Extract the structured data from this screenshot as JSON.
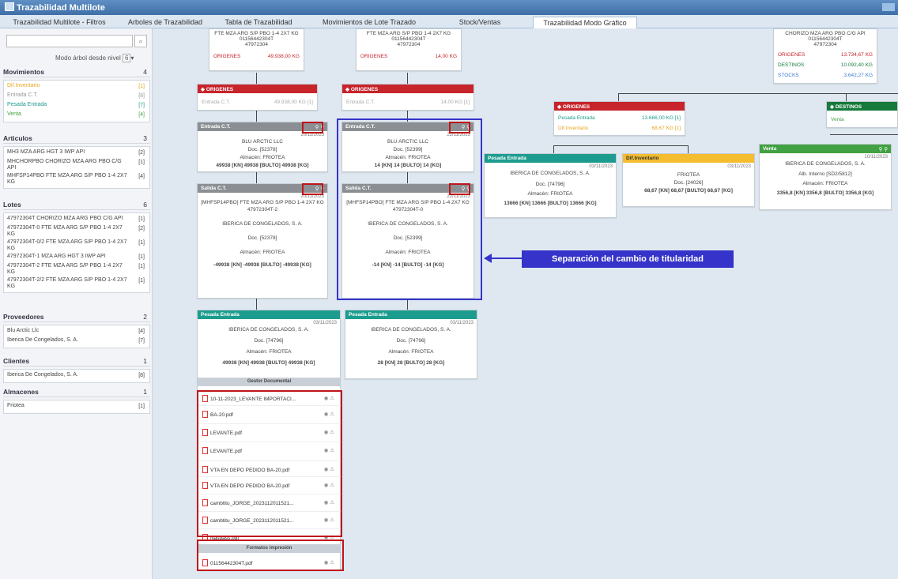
{
  "window": {
    "title": "Trazabilidad Multilote"
  },
  "tabs": [
    "Trazabilidad Multilote - Filtros",
    "Arboles de Trazabilidad",
    "Tabla de Trazabilidad",
    "Movimientos de Lote Trazado",
    "Stock/Ventas",
    "Trazabilidad Modo Gráfico"
  ],
  "sidebar": {
    "modo_label": "Modo árbol desde nivel",
    "modo_value": "6",
    "movimientos": {
      "title": "Movimientos",
      "count": "4",
      "items": [
        {
          "label": "Dif.Inventario",
          "count": "[1]"
        },
        {
          "label": "Entrada C.T.",
          "count": "[8]"
        },
        {
          "label": "Pesada Entrada",
          "count": "[7]"
        },
        {
          "label": "Venta",
          "count": "[4]"
        }
      ]
    },
    "articulos": {
      "title": "Articulos",
      "count": "3",
      "items": [
        {
          "label": "MH3 MZA ARG HGT 3 IWP API",
          "count": "[2]"
        },
        {
          "label": "MHCHORPBO CHORIZO MZA ARG PBO C/G API",
          "count": "[1]"
        },
        {
          "label": "MHFSP14PBO FTE MZA ARG S/P PBO 1-4 2X7 KG",
          "count": "[4]"
        }
      ]
    },
    "lotes": {
      "title": "Lotes",
      "count": "6",
      "items": [
        {
          "label": "47972304T CHORIZO MZA ARG PBO C/G API",
          "count": "[1]"
        },
        {
          "label": "47972304T-0 FTE MZA ARG S/P PBO 1-4 2X7 KG",
          "count": "[2]"
        },
        {
          "label": "47972304T-0/2 FTE MZA ARG S/P PBO 1-4 2X7 KG",
          "count": "[1]"
        },
        {
          "label": "47972304T-1 MZA ARG HGT 3 IWP API",
          "count": "[1]"
        },
        {
          "label": "47972304T-2 FTE MZA ARG S/P PBO 1-4 2X7 KG",
          "count": "[1]"
        },
        {
          "label": "47972304T-2/2 FTE MZA ARG S/P PBO 1-4 2X7 KG",
          "count": "[1]"
        }
      ]
    },
    "proveedores": {
      "title": "Proveedores",
      "count": "2",
      "items": [
        {
          "label": "Blu Arctic Llc",
          "count": "[4]"
        },
        {
          "label": "Iberica De Congelados, S. A.",
          "count": "[7]"
        }
      ]
    },
    "clientes": {
      "title": "Clientes",
      "count": "1",
      "items": [
        {
          "label": "Iberica De Congelados, S. A.",
          "count": "[8]"
        }
      ]
    },
    "almacenes": {
      "title": "Almacenes",
      "count": "1",
      "items": [
        {
          "label": "Friotea",
          "count": "[1]"
        }
      ]
    }
  },
  "graph": {
    "top_l": {
      "l1": "FTE MZA ARG S/P PBO 1-4 2X7 KG",
      "l2": "01156442304T",
      "l3": "47972304",
      "or": "ORIGENES",
      "orv": "49.938,00 KG"
    },
    "top_m": {
      "l1": "FTE MZA ARG S/P PBO 1-4 2X7 KG",
      "l2": "01156442304T",
      "l3": "47972304",
      "or": "ORIGENES",
      "orv": "14,00 KG"
    },
    "top_r": {
      "l1": "CHORIZO MZA ARG PBO C/G API",
      "l2": "01156442304T",
      "l3": "47972304",
      "or": "ORIGENES",
      "orv": "13.734,67 KG",
      "de": "DESTINOS",
      "dev": "10.092,40 KG",
      "st": "STOCKS",
      "stv": "3.642,27 KG"
    },
    "org_l": {
      "h": "ORIGENES",
      "i": "Entrada C.T.",
      "v": "49.938,00 KG [1]"
    },
    "org_m": {
      "h": "ORIGENES",
      "i": "Entrada C.T.",
      "v": "14,00 KG [1]"
    },
    "org_r": {
      "h": "ORIGENES",
      "i1": "Pesada Entrada",
      "v1": "13.666,00 KG [1]",
      "i2": "Dif.Inventario",
      "v2": "68,67 KG [1]"
    },
    "dest_r": {
      "h": "DESTINOS",
      "i": "Venta"
    },
    "ent_l": {
      "h": "Entrada C.T.",
      "d": "20/11/2023",
      "a": "BLU ARCTIC LLC",
      "b": "Doc. [52378]",
      "c": "Almacén: FRIOTEA",
      "e": "49938 [KN] 49938 [BULTO] 49938 [KG]"
    },
    "ent_m": {
      "h": "Entrada C.T.",
      "d": "22/11/2023",
      "a": "BLU ARCTIC LLC",
      "b": "Doc. [52399]",
      "c": "Almacén: FRIOTEA",
      "e": "14 [KN] 14 [BULTO] 14 [KG]"
    },
    "sal_l": {
      "h": "Salida C.T.",
      "d": "20/11/2023",
      "a": "[MHFSP14PBO] FTE MZA ARG S/P PBO 1-4 2X7 KG",
      "a2": "47972304T-2",
      "b": "IBERICA DE CONGELADOS, S. A.",
      "c": "Doc. [52378]",
      "c2": "Almacén: FRIOTEA",
      "e": "-49938 [KN] -49938 [BULTO] -49938 [KG]"
    },
    "sal_m": {
      "h": "Salida C.T.",
      "d": "22/11/2023",
      "a": "[MHFSP14PBO] FTE MZA ARG S/P PBO 1-4 2X7 KG",
      "a2": "47972304T-0",
      "b": "IBERICA DE CONGELADOS, S. A.",
      "c": "Doc. [52399]",
      "c2": "Almacén: FRIOTEA",
      "e": "-14 [KN] -14 [BULTO] -14 [KG]"
    },
    "pes_r": {
      "h": "Pesada Entrada",
      "d": "03/11/2023",
      "a": "IBERICA DE CONGELADOS, S. A.",
      "b": "Doc. [74796]",
      "c": "Almacén: FRIOTEA",
      "e": "13666 [KN] 13666 [BULTO] 13666 [KG]"
    },
    "dif_r": {
      "h": "Dif.Inventario",
      "d": "03/11/2023",
      "a": "FRIOTEA",
      "b": "Doc. [24026]",
      "c": "68,67 [KN] 68,67 [BULTO] 68,67 [KG]"
    },
    "ven_r": {
      "h": "Venta",
      "d": "10/11/2023",
      "a": "IBERICA DE CONGELADOS, S. A.",
      "b": "Alb. Interno [SD2/5812]",
      "c": "Almacén: FRIOTEA",
      "e": "3356,8 [KN] 3356,8 [BULTO] 3356,8 [KG]"
    },
    "pes_l": {
      "h": "Pesada Entrada",
      "d": "03/11/2023",
      "a": "IBERICA DE CONGELADOS, S. A.",
      "b": "Doc. [74796]",
      "c": "Almacén: FRIOTEA",
      "e": "49938 [KN] 49938 [BULTO] 49938 [KG]"
    },
    "pes_m": {
      "h": "Pesada Entrada",
      "d": "03/11/2023",
      "a": "IBERICA DE CONGELADOS, S. A.",
      "b": "Doc. [74796]",
      "c": "Almacén: FRIOTEA",
      "e": "28 [KN] 28 [BULTO] 28 [KG]"
    },
    "gestor": "Gestor Documental",
    "formatos": "Formatos impresión",
    "docs": [
      "10-11-2023_LEVANTE IMPORTACI...",
      "BA-20.pdf",
      "LEVANTE.pdf",
      "LEVANTE.pdf",
      "VTA EN DEPO PEDIDO BA-20.pdf",
      "VTA EN DEPO PEDIDO BA-20.pdf",
      "cambtitu_JORGE_2023112011521...",
      "cambtitu_JORGE_2023112011521...",
      "Naspass.pdf"
    ],
    "fdoc": "01156442304T.pdf",
    "annotation": "Separación del cambio de titularidad"
  }
}
